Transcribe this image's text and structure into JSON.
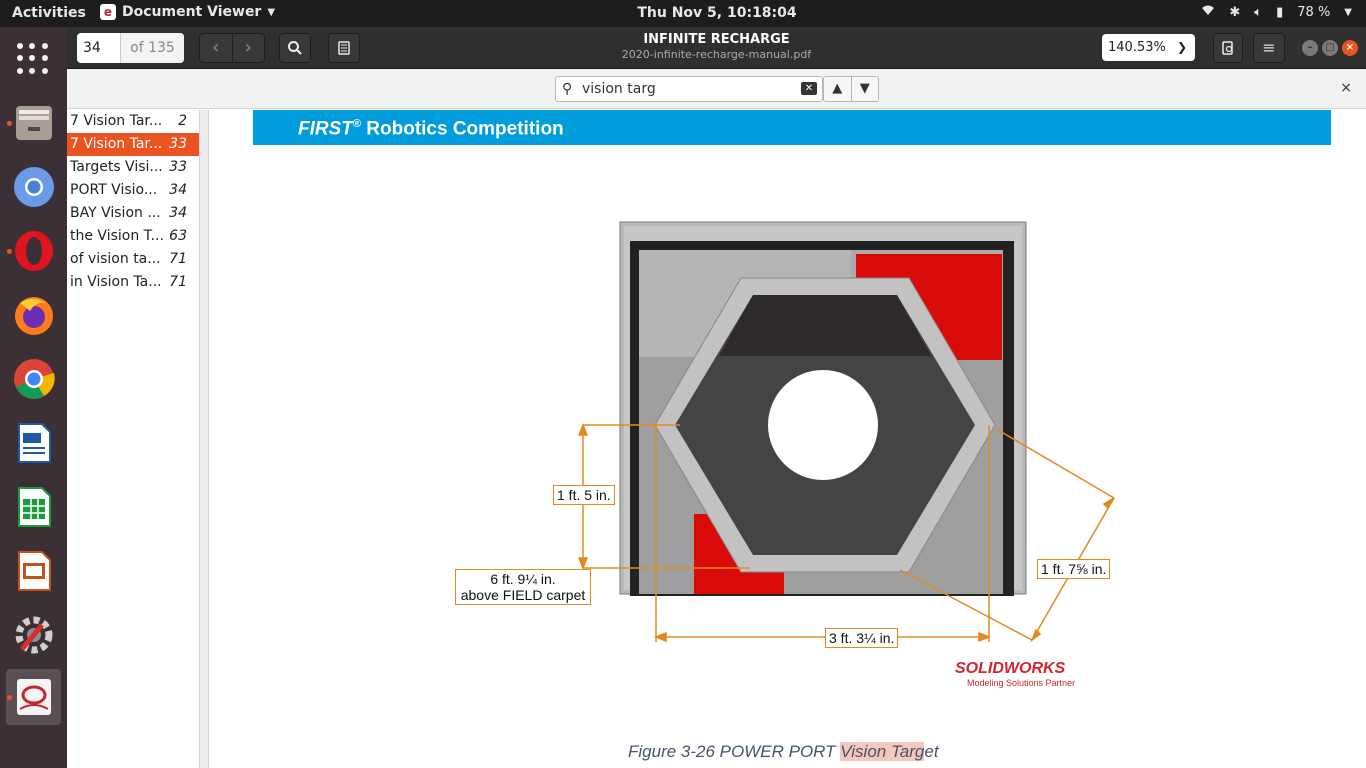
{
  "topbar": {
    "activities": "Activities",
    "app_name": "Document Viewer",
    "clock": "Thu Nov  5, 10:18:04",
    "battery": "78 %"
  },
  "dock": {
    "items": [
      "files",
      "chromium",
      "opera",
      "firefox",
      "chrome",
      "libreoffice-writer",
      "libreoffice-calc",
      "libreoffice-impress",
      "system-tools",
      "document-viewer"
    ]
  },
  "header": {
    "page_number": "34",
    "page_total": "of 135",
    "title": "INFINITE RECHARGE",
    "subtitle": "2020-infinite-recharge-manual.pdf",
    "zoom": "140.53%"
  },
  "find": {
    "query": "vision targ"
  },
  "results": [
    {
      "text": "7 Vision Tar...",
      "page": "2",
      "selected": false
    },
    {
      "text": "7 Vision Tar...",
      "page": "33",
      "selected": true
    },
    {
      "text": "Targets Visi...",
      "page": "33",
      "selected": false
    },
    {
      "text": "PORT Visio...",
      "page": "34",
      "selected": false
    },
    {
      "text": "BAY Vision ...",
      "page": "34",
      "selected": false
    },
    {
      "text": "the Vision T...",
      "page": "63",
      "selected": false
    },
    {
      "text": "of vision ta...",
      "page": "71",
      "selected": false
    },
    {
      "text": "in Vision Ta...",
      "page": "71",
      "selected": false
    }
  ],
  "document": {
    "banner_first": "FIRST",
    "banner_reg": "®",
    "banner_rest": " Robotics Competition",
    "dims": {
      "height_17": "1 ft. 5 in.",
      "height_floor_1": "6 ft. 9¼ in.",
      "height_floor_2": "above FIELD carpet",
      "width": "3 ft. 3¼ in.",
      "diag": "1 ft. 7⅝ in."
    },
    "sw_logo": "SOLIDWORKS",
    "sw_sub": "Modeling Solutions Partner",
    "caption_pre": "Figure 3-26 POWER PORT ",
    "caption_hl": "Vision Targ",
    "caption_post": "et"
  },
  "colors": {
    "accent": "#e95420",
    "banner": "#009cdb",
    "dimension": "#e38a1f",
    "target_red": "#d90a0a"
  }
}
